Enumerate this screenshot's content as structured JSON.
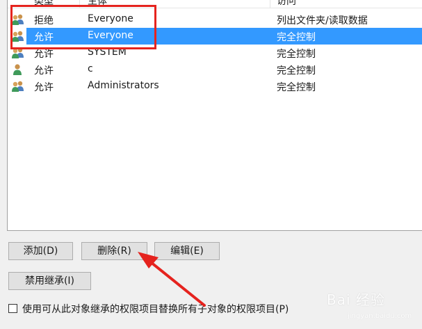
{
  "list": {
    "columns": [
      "类型",
      "主体",
      "访问"
    ],
    "rows": [
      {
        "type": "拒绝",
        "principal": "Everyone",
        "access": "列出文件夹/读取数据",
        "icon": "group-users-icon",
        "selected": false
      },
      {
        "type": "允许",
        "principal": "Everyone",
        "access": "完全控制",
        "icon": "group-users-icon",
        "selected": true
      },
      {
        "type": "允许",
        "principal": "SYSTEM",
        "access": "完全控制",
        "icon": "group-users-icon",
        "selected": false
      },
      {
        "type": "允许",
        "principal": "c",
        "access": "完全控制",
        "icon": "single-user-icon",
        "selected": false
      },
      {
        "type": "允许",
        "principal": "Administrators",
        "access": "完全控制",
        "icon": "group-users-icon",
        "selected": false
      }
    ]
  },
  "buttons": {
    "add": "添加(D)",
    "remove": "删除(R)",
    "edit": "编辑(E)",
    "disable_inheritance": "禁用继承(I)"
  },
  "checkbox": {
    "label": "使用可从此对象继承的权限项目替换所有子对象的权限项目(P)",
    "checked": false
  },
  "watermark": {
    "text": "Bai 经验",
    "sub": "jingyan.baidu.com"
  },
  "colors": {
    "selection": "#3399ff",
    "annotation_red": "#e5231e"
  }
}
